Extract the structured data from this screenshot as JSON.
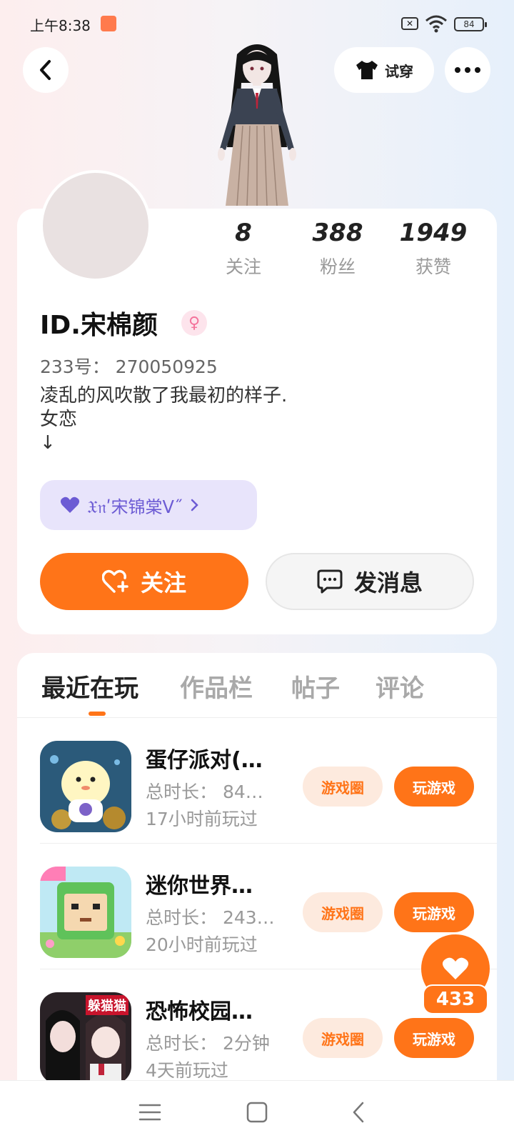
{
  "status_bar": {
    "time": "上午8:38",
    "battery": "84"
  },
  "header": {
    "try_on_label": "试穿"
  },
  "stats": [
    {
      "value": "8",
      "label": "关注"
    },
    {
      "value": "388",
      "label": "粉丝"
    },
    {
      "value": "1949",
      "label": "获赞"
    }
  ],
  "profile": {
    "nickname": "ID.宋棉颜",
    "uid": "233号： 270050925",
    "bio_lines": [
      "凌乱的风吹散了我最初的样子.",
      "女恋",
      "↓"
    ],
    "fan_badge": "𝔛𝔫ʹ宋锦棠ᐯ˝"
  },
  "actions": {
    "follow_label": "关注",
    "message_label": "发消息"
  },
  "tabs": [
    "最近在玩",
    "作品栏",
    "帖子",
    "评论"
  ],
  "games": [
    {
      "name": "蛋仔派对(…",
      "duration": "总时长： 84…",
      "last_played": "17小时前玩过",
      "circle_label": "游戏圈",
      "play_label": "玩游戏"
    },
    {
      "name": "迷你世界…",
      "duration": "总时长： 243…",
      "last_played": "20小时前玩过",
      "circle_label": "游戏圈",
      "play_label": "玩游戏"
    },
    {
      "name": "恐怖校园…",
      "duration": "总时长： 2分钟",
      "last_played": "4天前玩过",
      "circle_label": "游戏圈",
      "play_label": "玩游戏",
      "icon_text": "躲猫猫"
    }
  ],
  "like_fab": {
    "count": "433"
  },
  "colors": {
    "accent": "#ff7418",
    "badge_bg": "#e8e4fb",
    "badge_text": "#6c5bd4"
  }
}
